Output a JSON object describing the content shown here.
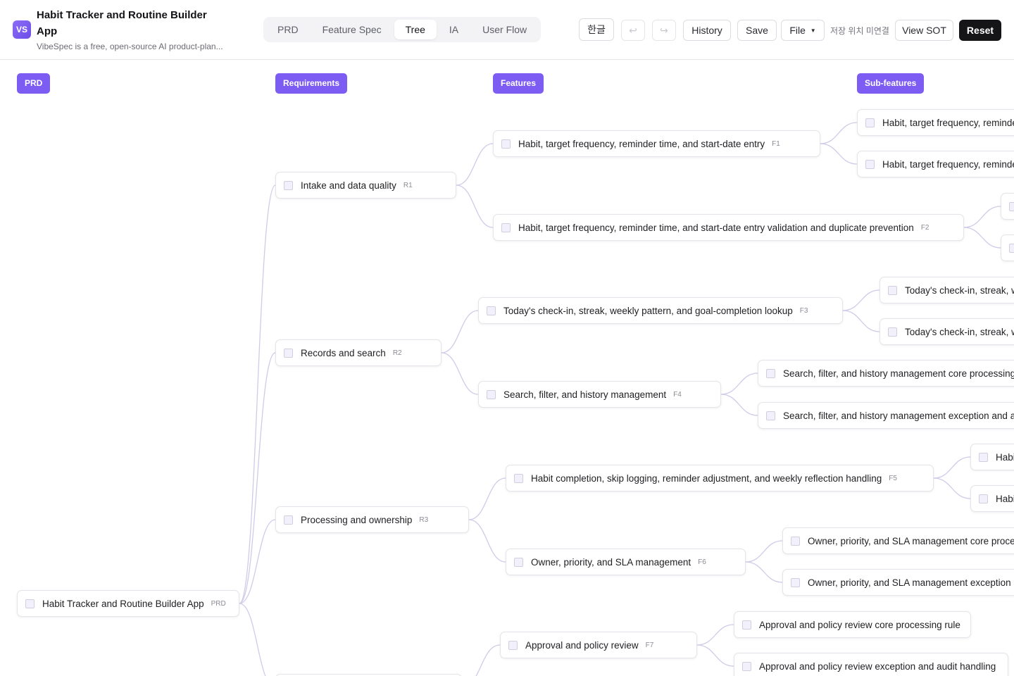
{
  "header": {
    "logo": "VS",
    "title": "Habit Tracker and Routine Builder App",
    "subtitle": "VibeSpec is a free, open-source AI product-plan...",
    "tabs": [
      {
        "label": "PRD"
      },
      {
        "label": "Feature Spec"
      },
      {
        "label": "Tree",
        "active": true
      },
      {
        "label": "IA"
      },
      {
        "label": "User Flow"
      }
    ],
    "language_button": "한글",
    "undo_icon": "↩",
    "redo_icon": "↪",
    "history_button": "History",
    "save_button": "Save",
    "file_button": "File",
    "save_status": "저장 위치 미연결",
    "view_sot_button": "View SOT",
    "reset_button": "Reset"
  },
  "columns": [
    "PRD",
    "Requirements",
    "Features",
    "Sub-features"
  ],
  "colors": {
    "accent": "#7c5cf2",
    "link": "#cfcbe8",
    "dark": "#151518"
  },
  "tree": {
    "root": {
      "label": "Habit Tracker and Routine Builder App",
      "code": "PRD"
    },
    "requirements": [
      {
        "label": "Intake and data quality",
        "code": "R1"
      },
      {
        "label": "Records and search",
        "code": "R2"
      },
      {
        "label": "Processing and ownership",
        "code": "R3"
      },
      {
        "label": "",
        "code": ""
      }
    ],
    "features": [
      {
        "label": "Habit, target frequency, reminder time, and start-date entry",
        "code": "F1"
      },
      {
        "label": "Habit, target frequency, reminder time, and start-date entry validation and duplicate prevention",
        "code": "F2"
      },
      {
        "label": "Today's check-in, streak, weekly pattern, and goal-completion lookup",
        "code": "F3"
      },
      {
        "label": "Search, filter, and history management",
        "code": "F4"
      },
      {
        "label": "Habit completion, skip logging, reminder adjustment, and weekly reflection handling",
        "code": "F5"
      },
      {
        "label": "Owner, priority, and SLA management",
        "code": "F6"
      },
      {
        "label": "Approval and policy review",
        "code": "F7"
      }
    ],
    "subfeatures": [
      {
        "label": "Habit, target frequency, reminder time, and start-date entry core processing rule"
      },
      {
        "label": "Habit, target frequency, reminder time, and start-date entry exception and audit handling"
      },
      {
        "label": ""
      },
      {
        "label": ""
      },
      {
        "label": "Today's check-in, streak, weekly pattern, and goal-completion lookup core processing rule"
      },
      {
        "label": "Today's check-in, streak, weekly pattern, and goal-completion lookup exception and audit handling"
      },
      {
        "label": "Search, filter, and history management core processing rule"
      },
      {
        "label": "Search, filter, and history management exception and audit handling"
      },
      {
        "label": "Habit completion, skip logging, reminder adjustment, and weekly reflection handling core processing rule"
      },
      {
        "label": "Habit completion, skip logging, reminder adjustment, and weekly reflection handling exception and audit handling"
      },
      {
        "label": "Owner, priority, and SLA management core processing rule"
      },
      {
        "label": "Owner, priority, and SLA management exception and audit handling"
      },
      {
        "label": "Approval and policy review core processing rule"
      },
      {
        "label": "Approval and policy review exception and audit handling"
      }
    ]
  }
}
